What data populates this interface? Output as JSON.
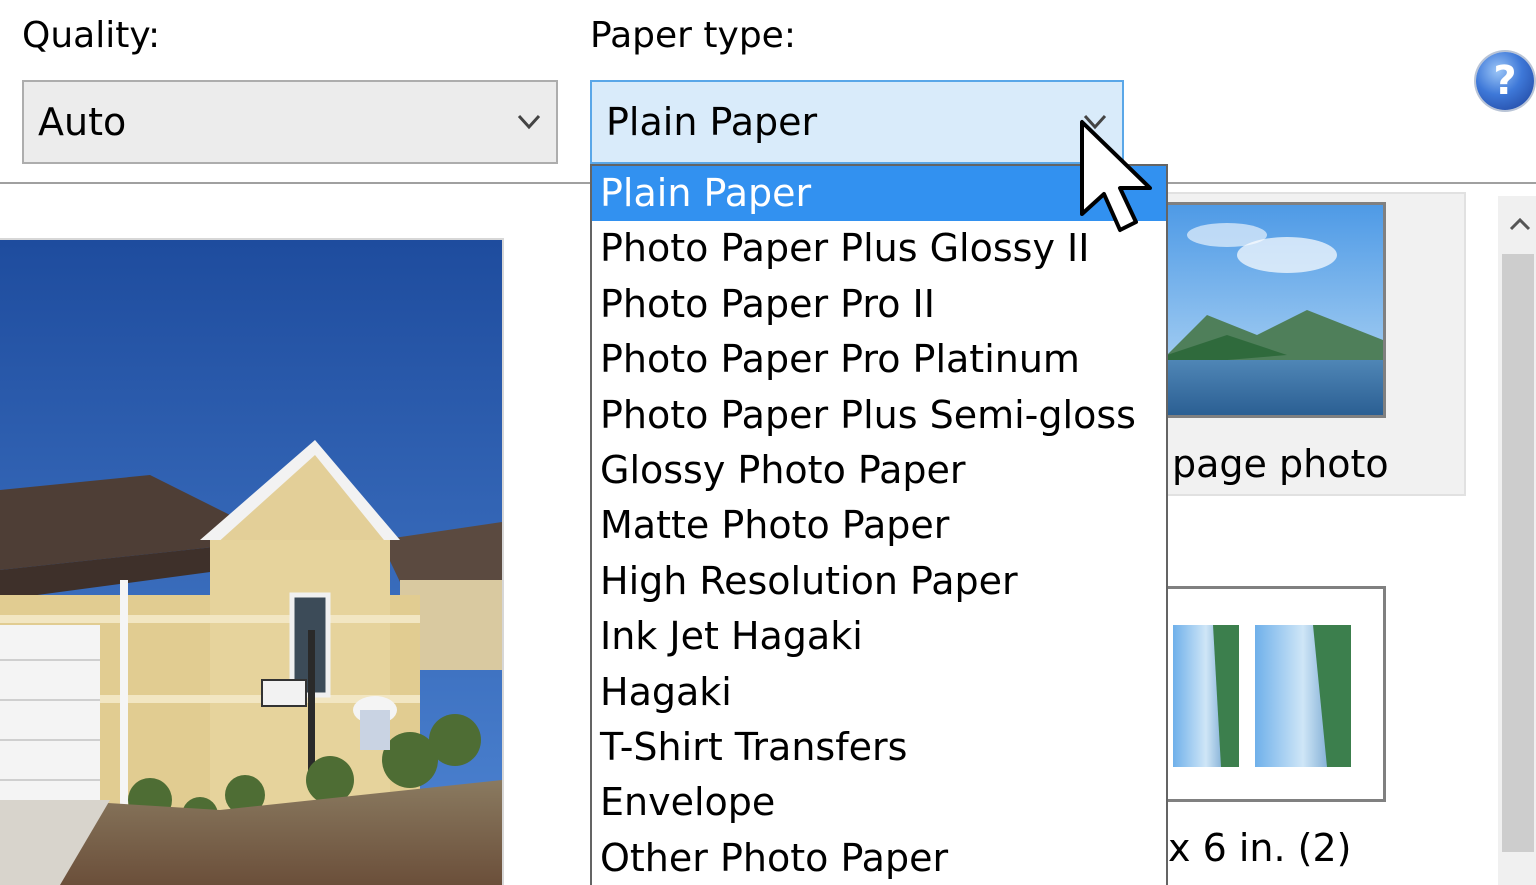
{
  "quality": {
    "label": "Quality:",
    "selected": "Auto"
  },
  "paper_type": {
    "label": "Paper type:",
    "selected": "Plain Paper",
    "options": [
      "Plain Paper",
      "Photo Paper Plus Glossy II",
      "Photo Paper Pro II",
      "Photo Paper Pro Platinum",
      "Photo Paper Plus Semi-gloss",
      "Glossy Photo Paper",
      "Matte Photo Paper",
      "High Resolution Paper",
      "Ink Jet Hagaki",
      "Hagaki",
      "T-Shirt Transfers",
      "Envelope",
      "Other Photo Paper"
    ],
    "highlighted_index": 0
  },
  "help": {
    "glyph": "?",
    "icon": "help-icon"
  },
  "layouts": {
    "full_page_caption": "page photo",
    "two_up_caption": "x 6 in. (2)"
  },
  "colors": {
    "selection": "#3291f0",
    "active_combo": "#d9ebfa",
    "combo": "#ececec"
  }
}
